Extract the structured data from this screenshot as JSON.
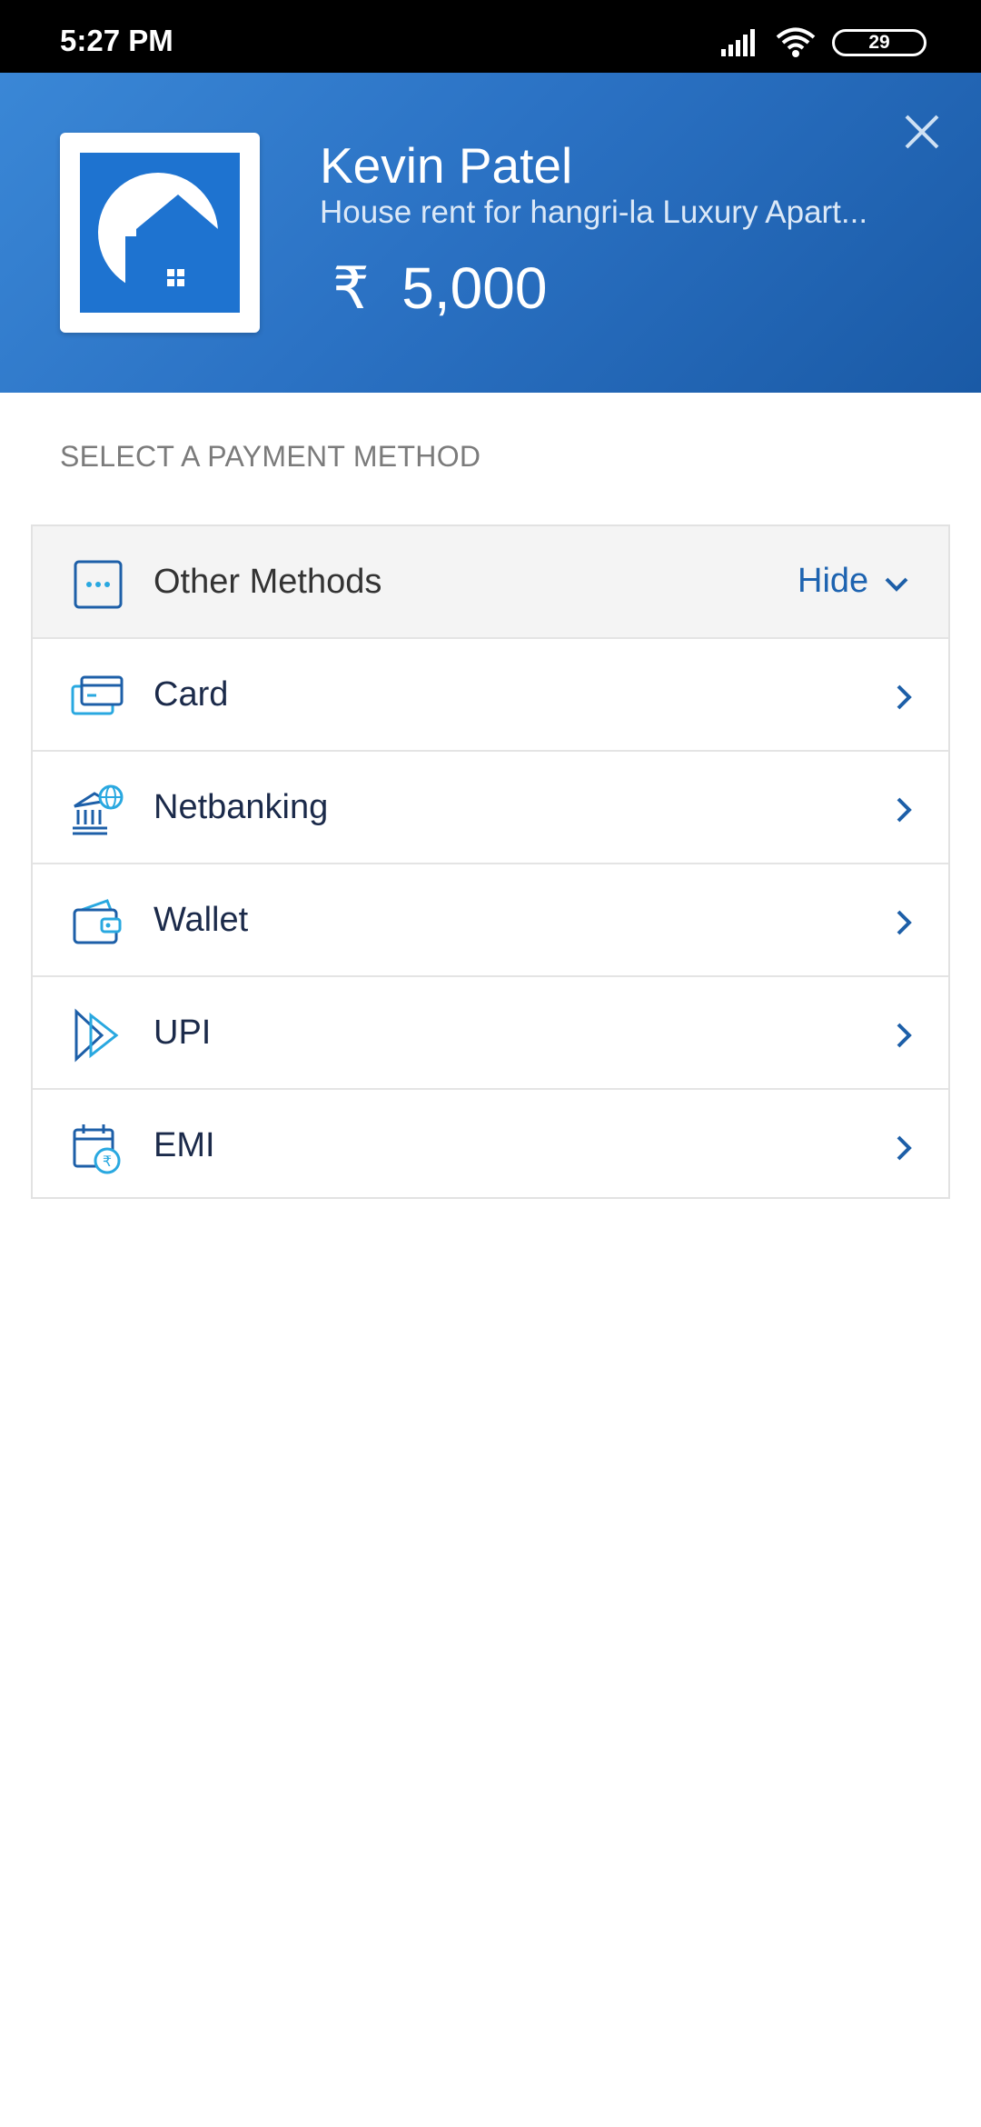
{
  "status_bar": {
    "time": "5:27 PM",
    "battery": "29"
  },
  "header": {
    "merchant_name": "Kevin Patel",
    "description": "House rent for hangri-la Luxury Apart...",
    "amount": "₹  5,000"
  },
  "payment": {
    "section_title": "SELECT A PAYMENT METHOD",
    "other_methods_label": "Other Methods",
    "hide_label": "Hide",
    "methods": [
      {
        "label": "Card",
        "icon": "card-icon"
      },
      {
        "label": "Netbanking",
        "icon": "bank-icon"
      },
      {
        "label": "Wallet",
        "icon": "wallet-icon"
      },
      {
        "label": "UPI",
        "icon": "upi-icon"
      },
      {
        "label": "EMI",
        "icon": "emi-calendar-icon"
      }
    ]
  },
  "colors": {
    "accent": "#1d63b0",
    "header_start": "#3a87d6",
    "header_end": "#1a5aa6",
    "icon_light": "#29a8e0"
  }
}
